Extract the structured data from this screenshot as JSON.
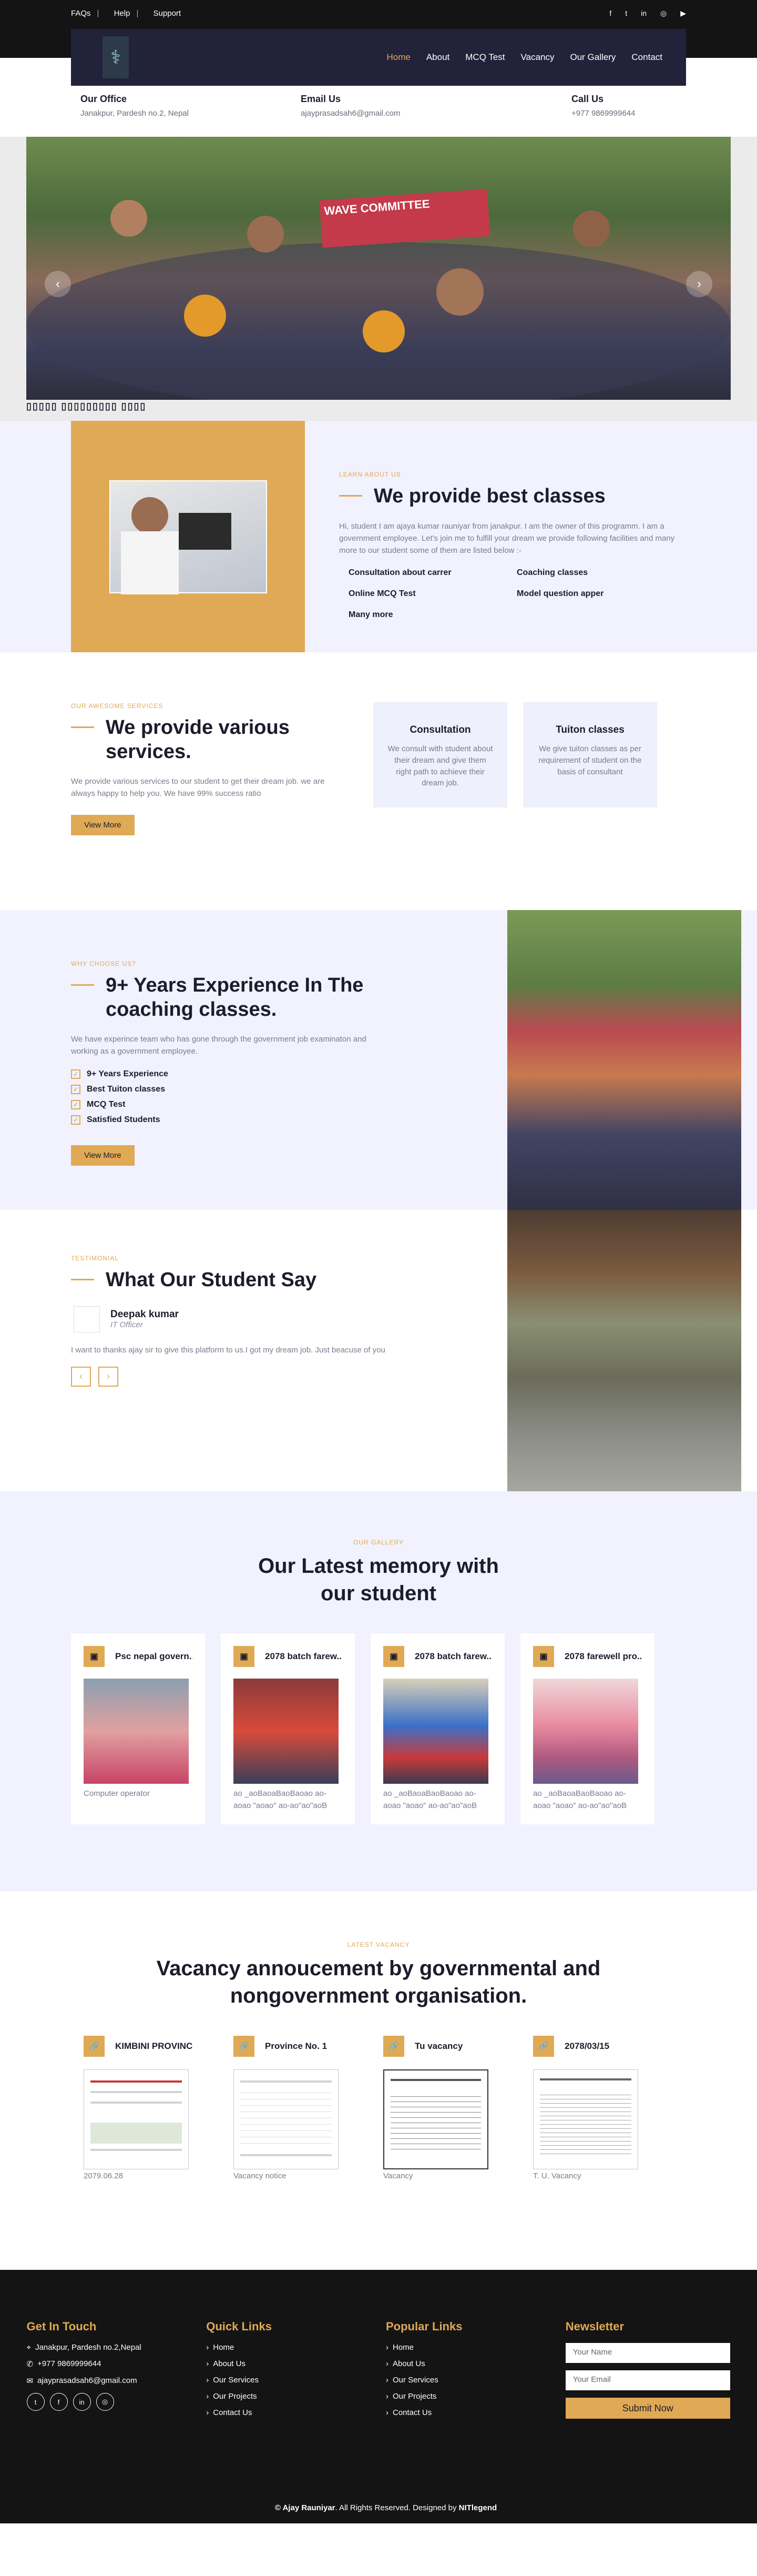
{
  "topbar": {
    "links": [
      "FAQs",
      "Help",
      "Support"
    ],
    "socials": [
      "facebook-icon",
      "twitter-icon",
      "linkedin-icon",
      "instagram-icon",
      "youtube-icon"
    ]
  },
  "nav": {
    "items": [
      "Home",
      "About",
      "MCQ Test",
      "Vacancy",
      "Our Gallery",
      "Contact"
    ]
  },
  "info": {
    "office_title": "Our Office",
    "office_value": "Janakpur, Pardesh no.2, Nepal",
    "email_title": "Email Us",
    "email_value": "ajayprasadsah6@gmail.com",
    "call_title": "Call Us",
    "call_value": "+977 9869999644"
  },
  "hero": {
    "banner_text": "WAVE COMMITTEE",
    "caption": "▯▯▯▯▯ ▯▯▯▯▯▯▯▯▯ ▯▯▯▯"
  },
  "about": {
    "eyebrow": "LEARN ABOUT US",
    "title": "We provide best classes",
    "paragraph": "Hi, student I am ajaya kumar rauniyar from janakpur. I am the owner of this programm. I am a government employee. Let's join me to fulfill your dream we provide following facilities and many more to our student some of them are listed below :-",
    "features": [
      "Consultation about carrer",
      "Coaching classes",
      "Online MCQ Test",
      "Model question apper",
      "Many more"
    ]
  },
  "services": {
    "eyebrow": "OUR AWESOME SERVICES",
    "title": "We provide various services.",
    "paragraph": "We provide various services to our student to get their dream job. we are always happy to help you. We have 99% success ratio",
    "button": "View More",
    "cards": [
      {
        "title": "Consultation",
        "text": "We consult with student about their dream and give them right path to achieve their dream job."
      },
      {
        "title": "Tuiton classes",
        "text": "We give tuiton classes as per requirement of student on the basis of consultant"
      }
    ]
  },
  "why": {
    "eyebrow": "WHY CHOOSE US?",
    "title": "9+ Years Experience In The coaching classes.",
    "paragraph": "We have experince team who has gone through the government job examinaton and working as a government employee.",
    "checks": [
      "9+ Years Experience",
      "Best Tuiton classes",
      "MCQ Test",
      "Satisfied Students"
    ],
    "button": "View More"
  },
  "testimonial": {
    "eyebrow": "TESTIMONIAL",
    "title": "What Our Student Say",
    "name": "Deepak kumar",
    "role": "IT Officer",
    "quote": "I want to thanks ajay sir to give this platform to us.I got my dream job. Just beacuse of you"
  },
  "gallery": {
    "eyebrow": "OUR GALLERY",
    "title": "Our Latest memory with our student",
    "cards": [
      {
        "title": "Psc nepal govern...",
        "caption": "Computer operator"
      },
      {
        "title": "2078 batch farew...",
        "caption": "ao _aoBaoaBaoBaoao ao-aoao \"aoao\" ao-ao\"ao\"aoB"
      },
      {
        "title": "2078 batch farew...",
        "caption": "ao _aoBaoaBaoBaoao ao-aoao \"aoao\" ao-ao\"ao\"aoB"
      },
      {
        "title": "2078 farewell pro...",
        "caption": "ao _aoBaoaBaoBaoao ao-aoao \"aoao\" ao-ao\"ao\"aoB"
      }
    ]
  },
  "vacancy": {
    "eyebrow": "LATEST VACANCY",
    "title": "Vacancy annoucement by governmental and nongovernment organisation.",
    "cards": [
      {
        "title": "KIMBINI PROVINC...",
        "caption": "2079.06.28"
      },
      {
        "title": "Province No. 1",
        "caption": "Vacancy notice"
      },
      {
        "title": "Tu vacancy",
        "caption": "Vacancy"
      },
      {
        "title": "2078/03/15",
        "caption": "T. U. Vacancy"
      }
    ]
  },
  "footer": {
    "touch_title": "Get In Touch",
    "address": "Janakpur, Pardesh no.2,Nepal",
    "phone": "+977 9869999644",
    "email": "ajayprasadsah6@gmail.com",
    "quick_title": "Quick Links",
    "quick_links": [
      "Home",
      "About Us",
      "Our Services",
      "Our Projects",
      "Contact Us"
    ],
    "popular_title": "Popular Links",
    "popular_links": [
      "Home",
      "About Us",
      "Our Services",
      "Our Projects",
      "Contact Us"
    ],
    "newsletter_title": "Newsletter",
    "name_placeholder": "Your Name",
    "email_placeholder": "Your Email",
    "submit": "Submit Now",
    "copyright_owner": "© Ajay Rauniyar",
    "copyright_text": ". All Rights Reserved. Designed by ",
    "designer": "NITlegend"
  },
  "colors": {
    "accent": "#e0a955",
    "navy": "#22223a",
    "lavender": "#f1f2fd",
    "dark": "#141414"
  }
}
